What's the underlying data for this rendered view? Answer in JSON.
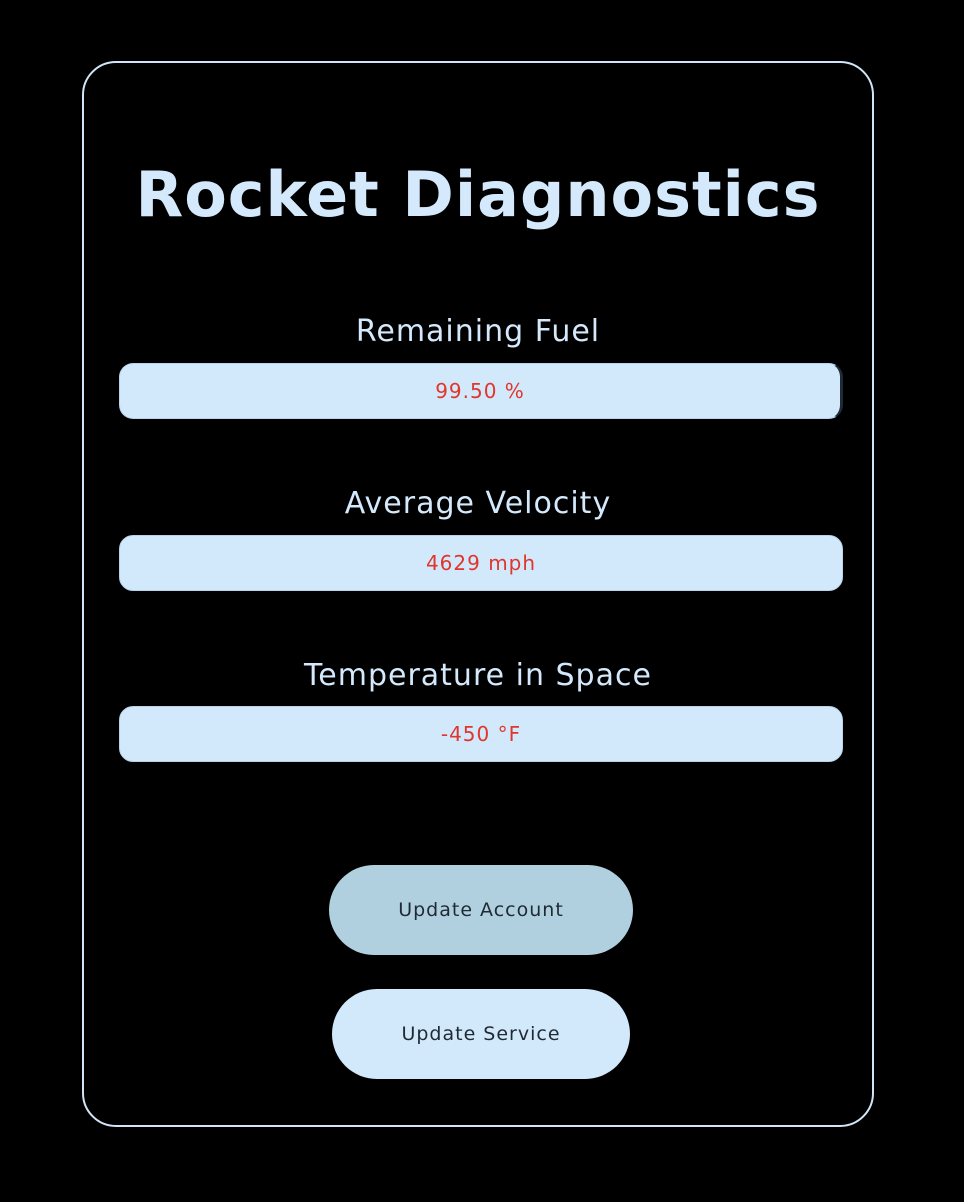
{
  "app": {
    "title": "Rocket Diagnostics"
  },
  "metrics": [
    {
      "label": "Remaining Fuel",
      "value": "99.50 %"
    },
    {
      "label": "Average Velocity",
      "value": "4629 mph"
    },
    {
      "label": "Temperature in Space",
      "value": "-450 °F"
    }
  ],
  "actions": {
    "update_account_label": "Update Account",
    "update_service_label": "Update Service"
  },
  "colors": {
    "background": "#000000",
    "panel_border": "#d0e6f8",
    "text_light": "#d4e9fb",
    "field_background": "#d2e8fb",
    "value_text": "#e0362c",
    "account_button": "#b0d0e0",
    "service_button": "#d2e8fb"
  }
}
